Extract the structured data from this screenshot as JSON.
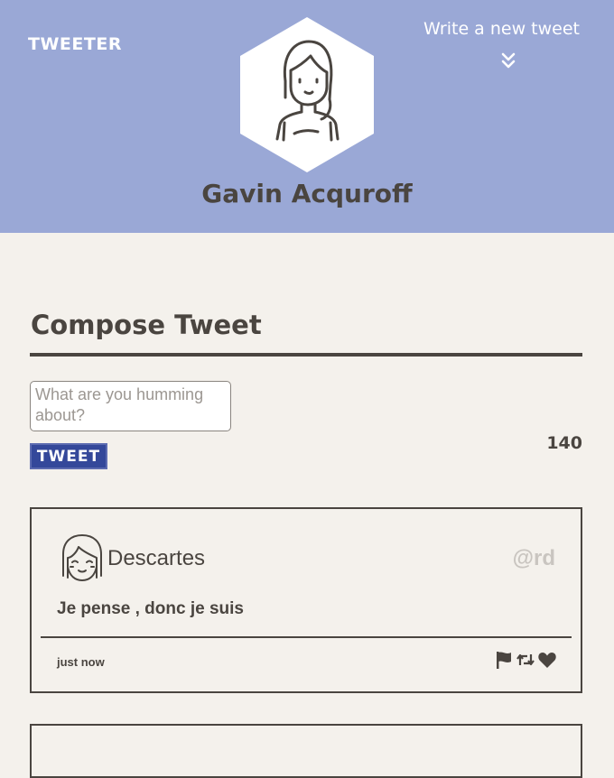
{
  "header": {
    "brand": "TWEETER",
    "write_link": "Write a new tweet",
    "user_name": "Gavin Acquroff",
    "background_color": "#9aa8d6"
  },
  "compose": {
    "title": "Compose Tweet",
    "placeholder": "What are you humming about?",
    "button_label": "TWEET",
    "counter": "140"
  },
  "tweets": [
    {
      "author": "Descartes",
      "handle": "@rd",
      "text": "Je pense , donc je suis",
      "time": "just now",
      "actions": [
        "flag-icon",
        "retweet-icon",
        "heart-icon"
      ]
    }
  ]
}
